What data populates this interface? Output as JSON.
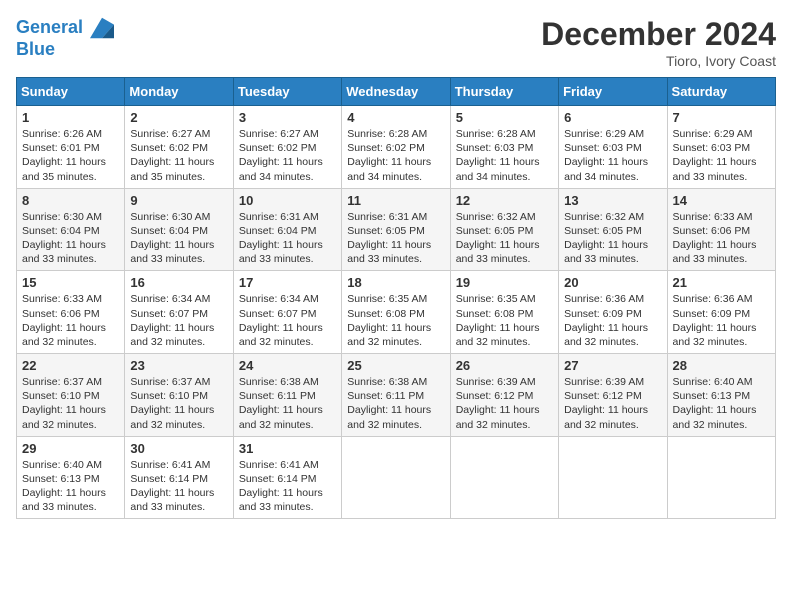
{
  "header": {
    "logo_line1": "General",
    "logo_line2": "Blue",
    "month_title": "December 2024",
    "location": "Tioro, Ivory Coast"
  },
  "weekdays": [
    "Sunday",
    "Monday",
    "Tuesday",
    "Wednesday",
    "Thursday",
    "Friday",
    "Saturday"
  ],
  "weeks": [
    [
      {
        "day": "1",
        "info": "Sunrise: 6:26 AM\nSunset: 6:01 PM\nDaylight: 11 hours\nand 35 minutes."
      },
      {
        "day": "2",
        "info": "Sunrise: 6:27 AM\nSunset: 6:02 PM\nDaylight: 11 hours\nand 35 minutes."
      },
      {
        "day": "3",
        "info": "Sunrise: 6:27 AM\nSunset: 6:02 PM\nDaylight: 11 hours\nand 34 minutes."
      },
      {
        "day": "4",
        "info": "Sunrise: 6:28 AM\nSunset: 6:02 PM\nDaylight: 11 hours\nand 34 minutes."
      },
      {
        "day": "5",
        "info": "Sunrise: 6:28 AM\nSunset: 6:03 PM\nDaylight: 11 hours\nand 34 minutes."
      },
      {
        "day": "6",
        "info": "Sunrise: 6:29 AM\nSunset: 6:03 PM\nDaylight: 11 hours\nand 34 minutes."
      },
      {
        "day": "7",
        "info": "Sunrise: 6:29 AM\nSunset: 6:03 PM\nDaylight: 11 hours\nand 33 minutes."
      }
    ],
    [
      {
        "day": "8",
        "info": "Sunrise: 6:30 AM\nSunset: 6:04 PM\nDaylight: 11 hours\nand 33 minutes."
      },
      {
        "day": "9",
        "info": "Sunrise: 6:30 AM\nSunset: 6:04 PM\nDaylight: 11 hours\nand 33 minutes."
      },
      {
        "day": "10",
        "info": "Sunrise: 6:31 AM\nSunset: 6:04 PM\nDaylight: 11 hours\nand 33 minutes."
      },
      {
        "day": "11",
        "info": "Sunrise: 6:31 AM\nSunset: 6:05 PM\nDaylight: 11 hours\nand 33 minutes."
      },
      {
        "day": "12",
        "info": "Sunrise: 6:32 AM\nSunset: 6:05 PM\nDaylight: 11 hours\nand 33 minutes."
      },
      {
        "day": "13",
        "info": "Sunrise: 6:32 AM\nSunset: 6:05 PM\nDaylight: 11 hours\nand 33 minutes."
      },
      {
        "day": "14",
        "info": "Sunrise: 6:33 AM\nSunset: 6:06 PM\nDaylight: 11 hours\nand 33 minutes."
      }
    ],
    [
      {
        "day": "15",
        "info": "Sunrise: 6:33 AM\nSunset: 6:06 PM\nDaylight: 11 hours\nand 32 minutes."
      },
      {
        "day": "16",
        "info": "Sunrise: 6:34 AM\nSunset: 6:07 PM\nDaylight: 11 hours\nand 32 minutes."
      },
      {
        "day": "17",
        "info": "Sunrise: 6:34 AM\nSunset: 6:07 PM\nDaylight: 11 hours\nand 32 minutes."
      },
      {
        "day": "18",
        "info": "Sunrise: 6:35 AM\nSunset: 6:08 PM\nDaylight: 11 hours\nand 32 minutes."
      },
      {
        "day": "19",
        "info": "Sunrise: 6:35 AM\nSunset: 6:08 PM\nDaylight: 11 hours\nand 32 minutes."
      },
      {
        "day": "20",
        "info": "Sunrise: 6:36 AM\nSunset: 6:09 PM\nDaylight: 11 hours\nand 32 minutes."
      },
      {
        "day": "21",
        "info": "Sunrise: 6:36 AM\nSunset: 6:09 PM\nDaylight: 11 hours\nand 32 minutes."
      }
    ],
    [
      {
        "day": "22",
        "info": "Sunrise: 6:37 AM\nSunset: 6:10 PM\nDaylight: 11 hours\nand 32 minutes."
      },
      {
        "day": "23",
        "info": "Sunrise: 6:37 AM\nSunset: 6:10 PM\nDaylight: 11 hours\nand 32 minutes."
      },
      {
        "day": "24",
        "info": "Sunrise: 6:38 AM\nSunset: 6:11 PM\nDaylight: 11 hours\nand 32 minutes."
      },
      {
        "day": "25",
        "info": "Sunrise: 6:38 AM\nSunset: 6:11 PM\nDaylight: 11 hours\nand 32 minutes."
      },
      {
        "day": "26",
        "info": "Sunrise: 6:39 AM\nSunset: 6:12 PM\nDaylight: 11 hours\nand 32 minutes."
      },
      {
        "day": "27",
        "info": "Sunrise: 6:39 AM\nSunset: 6:12 PM\nDaylight: 11 hours\nand 32 minutes."
      },
      {
        "day": "28",
        "info": "Sunrise: 6:40 AM\nSunset: 6:13 PM\nDaylight: 11 hours\nand 32 minutes."
      }
    ],
    [
      {
        "day": "29",
        "info": "Sunrise: 6:40 AM\nSunset: 6:13 PM\nDaylight: 11 hours\nand 33 minutes."
      },
      {
        "day": "30",
        "info": "Sunrise: 6:41 AM\nSunset: 6:14 PM\nDaylight: 11 hours\nand 33 minutes."
      },
      {
        "day": "31",
        "info": "Sunrise: 6:41 AM\nSunset: 6:14 PM\nDaylight: 11 hours\nand 33 minutes."
      },
      null,
      null,
      null,
      null
    ]
  ]
}
